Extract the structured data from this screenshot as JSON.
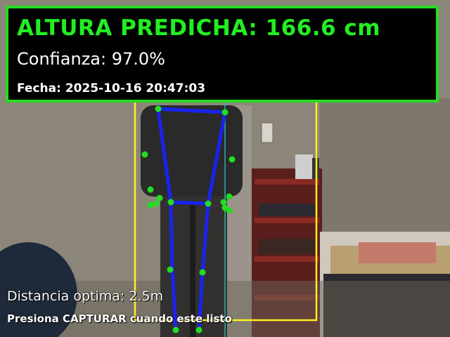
{
  "overlay": {
    "title": "ALTURA PREDICHA: 166.6 cm",
    "confidence": "Confianza: 97.0%",
    "date": "Fecha: 2025-10-16 20:47:03",
    "distance_hint": "Distancia optima: 2.5m",
    "instruction": "Presiona CAPTURAR cuando este listo"
  },
  "colors": {
    "panel_border": "#22dd22",
    "title_text": "#22ee22",
    "skeleton": "#1a22ee",
    "keypoint": "#22dd22",
    "bounding_box": "#ffee22",
    "guide_line": "#33cccc"
  }
}
